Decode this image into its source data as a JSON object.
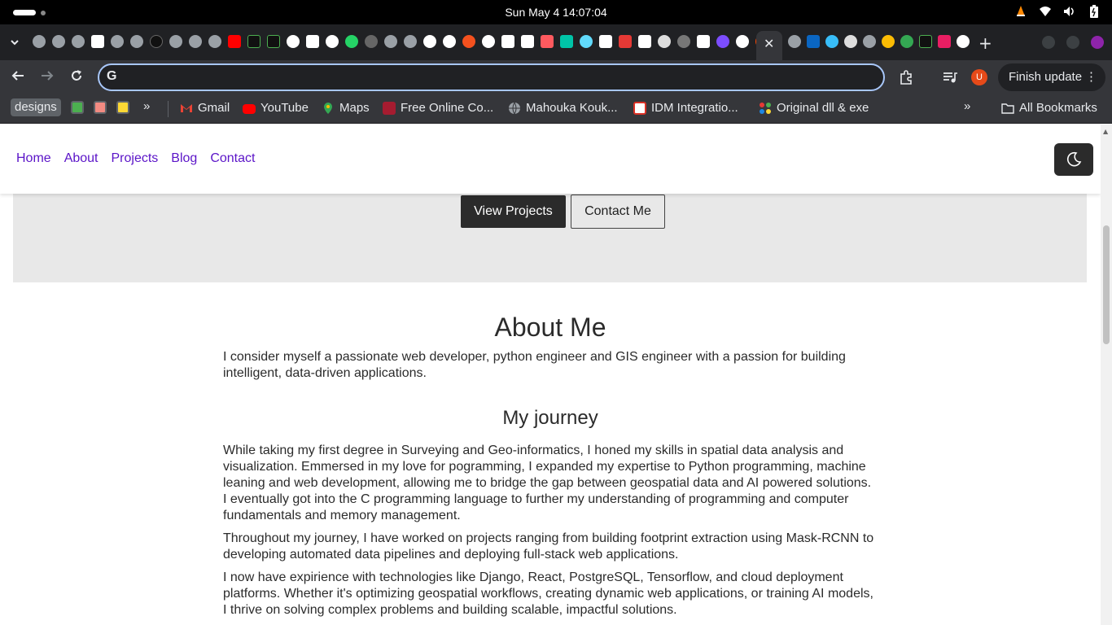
{
  "os": {
    "clock": "Sun May 4  14:07:04",
    "tray_icons": [
      "vlc-icon",
      "wifi-icon",
      "volume-icon",
      "battery-icon"
    ]
  },
  "browser": {
    "active_tab_close": "✕",
    "new_tab": "+",
    "omnibox": {
      "value": "",
      "placeholder": ""
    },
    "avatar_letter": "U",
    "finish_update": "Finish update",
    "bookmarks": {
      "folder_designs": "designs",
      "more_left": "»",
      "items": [
        {
          "label": "Gmail",
          "icon": "gmail-icon",
          "color": "#ea4335"
        },
        {
          "label": "YouTube",
          "icon": "youtube-icon",
          "color": "#ff0000"
        },
        {
          "label": "Maps",
          "icon": "maps-icon",
          "color": "#34a853"
        },
        {
          "label": "Free Online Co...",
          "icon": "harvard-icon",
          "color": "#a51c30"
        },
        {
          "label": "Mahouka Kouk...",
          "icon": "globe-icon",
          "color": "#9aa0a6"
        },
        {
          "label": "IDM Integratio...",
          "icon": "idm-icon",
          "color": "#d93025"
        },
        {
          "label": "Original dll & exe",
          "icon": "dll-icon",
          "color": "#4caf50"
        }
      ],
      "more_right": "»",
      "all_bookmarks": "All Bookmarks"
    }
  },
  "site": {
    "nav": {
      "links": [
        "Home",
        "About",
        "Projects",
        "Blog",
        "Contact"
      ]
    },
    "hero": {
      "view_projects": "View Projects",
      "contact_me": "Contact Me"
    },
    "about": {
      "title": "About Me",
      "intro": "I consider myself a passionate web developer, python engineer and GIS engineer with a passion for building intelligent, data-driven applications.",
      "journey_title": "My journey",
      "paragraphs": [
        "While taking my first degree in Surveying and Geo-informatics, I honed my skills in spatial data analysis and visualization. Emmersed in my love for pogramming, I expanded my expertise to Python programming, machine leaning and web development, allowing me to bridge the gap between geospatial data and AI powered solutions. I eventually got into the C programming language to further my understanding of programming and computer fundamentals and memory management.",
        "Throughout my journey, I have worked on projects ranging from building footprint extraction using Mask-RCNN to developing automated data pipelines and deploying full-stack web applications.",
        "I now have expirience with technologies like Django, React, PostgreSQL, Tensorflow, and cloud deployment platforms. Whether it's optimizing geospatial workflows, creating dynamic web applications, or training AI models, I thrive on solving complex problems and building scalable, impactful solutions."
      ]
    }
  }
}
